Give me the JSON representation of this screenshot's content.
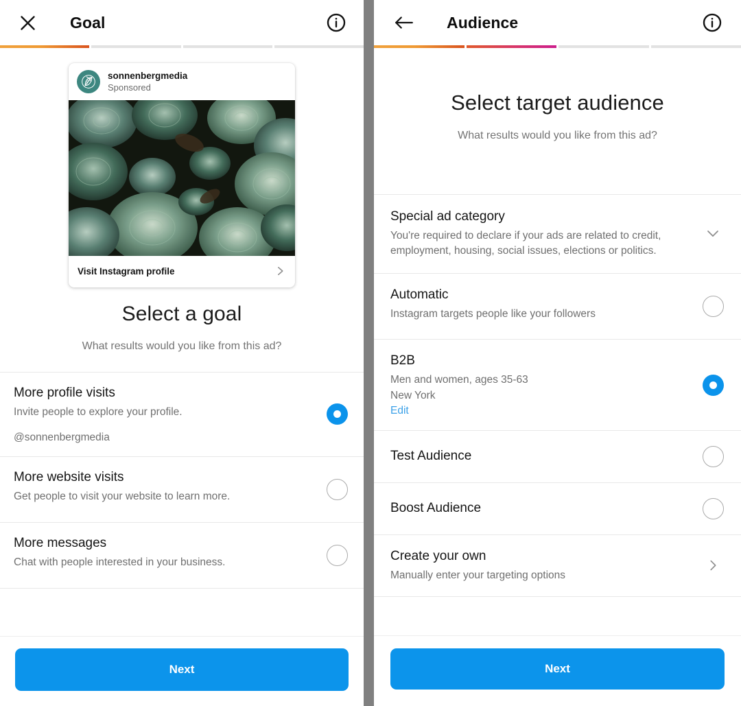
{
  "colors": {
    "accent_blue": "#0c94eb",
    "link_blue": "#3aa0e8",
    "progress_orange": "#ef9a33",
    "progress_magenta": "#cc1e8c",
    "avatar_teal": "#3d8780",
    "divider_gray": "#808080"
  },
  "left_panel": {
    "appbar": {
      "close_icon": "close-icon",
      "title": "Goal",
      "info_icon": "info-icon"
    },
    "progress": {
      "total_steps": 4,
      "filled_steps": 1
    },
    "ad_preview": {
      "username": "sonnenbergmedia",
      "sponsored_label": "Sponsored",
      "avatar_icon": "leaf-logo-icon",
      "photo_alt": "succulent-plants-photo",
      "cta_label": "Visit Instagram profile",
      "cta_chevron_icon": "chevron-right-icon"
    },
    "heading": {
      "title": "Select a goal",
      "subtitle": "What results would you like from this ad?"
    },
    "options": [
      {
        "title": "More profile visits",
        "desc": "Invite people to explore your profile.",
        "extra": "@sonnenbergmedia",
        "selected": true
      },
      {
        "title": "More website visits",
        "desc": "Get people to visit your website to learn more.",
        "selected": false
      },
      {
        "title": "More messages",
        "desc": "Chat with people interested in your business.",
        "selected": false
      }
    ],
    "footer": {
      "next_label": "Next"
    }
  },
  "right_panel": {
    "appbar": {
      "back_icon": "arrow-left-icon",
      "title": "Audience",
      "info_icon": "info-icon"
    },
    "progress": {
      "total_steps": 4,
      "filled_steps": 2
    },
    "heading": {
      "title": "Select target audience",
      "subtitle": "What results would you like from this ad?"
    },
    "special_ad_category": {
      "title": "Special ad category",
      "desc": "You're required to declare if your ads are related to credit, employment, housing, social issues, elections or politics.",
      "chevron_icon": "chevron-down-icon"
    },
    "audiences": [
      {
        "title": "Automatic",
        "desc": "Instagram targets people like your followers",
        "selected": false
      },
      {
        "title": "B2B",
        "desc": "Men and women, ages 35-63",
        "location": "New York",
        "edit_label": "Edit",
        "selected": true
      },
      {
        "title": "Test Audience",
        "selected": false
      },
      {
        "title": "Boost Audience",
        "selected": false
      }
    ],
    "create_your_own": {
      "title": "Create your own",
      "desc": "Manually enter your targeting options",
      "chevron_icon": "chevron-right-icon"
    },
    "footer": {
      "next_label": "Next"
    }
  }
}
